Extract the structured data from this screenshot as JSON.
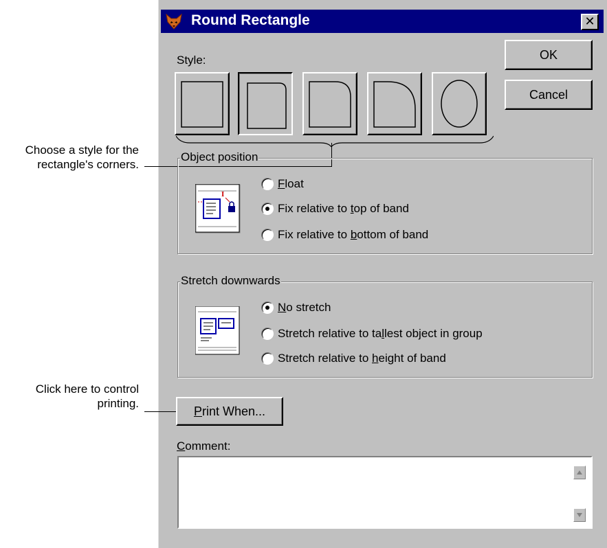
{
  "callouts": {
    "style_line1": "Choose a style for the",
    "style_line2": "rectangle's corners.",
    "print_line1": "Click here to control",
    "print_line2": "printing."
  },
  "dialog": {
    "title": "Round Rectangle",
    "close_glyph": "✕",
    "style_label": "Style:",
    "ok_label": "OK",
    "cancel_label": "Cancel",
    "style_options": [
      "square-corners",
      "slightly-rounded",
      "medium-rounded",
      "very-rounded",
      "ellipse"
    ],
    "selected_style": "slightly-rounded"
  },
  "object_position": {
    "label": "Object position",
    "options": [
      {
        "accel": "F",
        "rest": "loat",
        "checked": false
      },
      {
        "pre": "Fix relative to ",
        "accel": "t",
        "rest": "op of band",
        "checked": true
      },
      {
        "pre": "Fix relative to ",
        "accel": "b",
        "rest": "ottom of band",
        "checked": false
      }
    ]
  },
  "stretch": {
    "label": "Stretch downwards",
    "options": [
      {
        "accel": "N",
        "rest": "o stretch",
        "checked": true
      },
      {
        "pre": "Stretch relative to ta",
        "accel": "l",
        "rest": "lest object in group",
        "checked": false
      },
      {
        "pre": "Stretch relative to ",
        "accel": "h",
        "rest": "eight of band",
        "checked": false
      }
    ]
  },
  "print_when": {
    "accel": "P",
    "rest": "rint When..."
  },
  "comment": {
    "accel": "C",
    "rest": "omment:",
    "value": ""
  },
  "icons": [
    "fox-app-icon",
    "close-icon",
    "position-icon",
    "stretch-icon",
    "scroll-up-icon",
    "scroll-down-icon"
  ]
}
